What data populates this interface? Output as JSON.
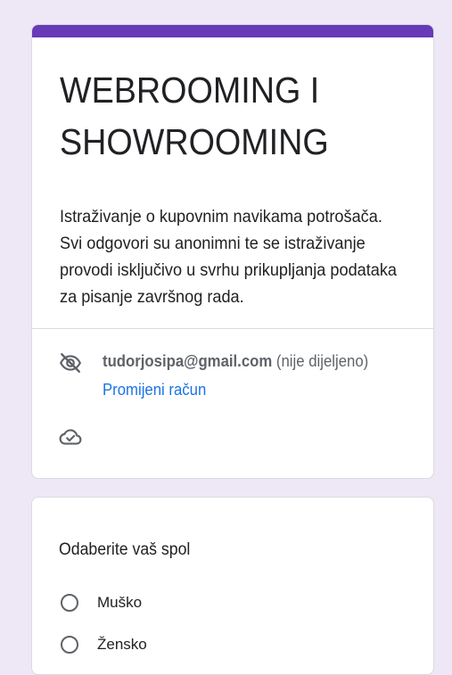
{
  "colors": {
    "background": "#ede7f6",
    "accent": "#673ab7",
    "link": "#1a73e8"
  },
  "form": {
    "title": "WEBROOMING I SHOWROOMING",
    "description": "Istraživanje o kupovnim navikama potrošača. Svi odgovori su anonimni te se istraživanje provodi isključivo u svrhu prikupljanja podataka za pisanje završnog rada."
  },
  "account": {
    "email": "tudorjosipa@gmail.com",
    "note": "(nije dijeljeno)",
    "change_label": "Promijeni račun",
    "visibility_icon": "visibility-off-icon",
    "saved_icon": "cloud-done-icon"
  },
  "question": {
    "title": "Odaberite vaš spol",
    "options": [
      {
        "label": "Muško",
        "selected": false
      },
      {
        "label": "Žensko",
        "selected": false
      }
    ]
  }
}
